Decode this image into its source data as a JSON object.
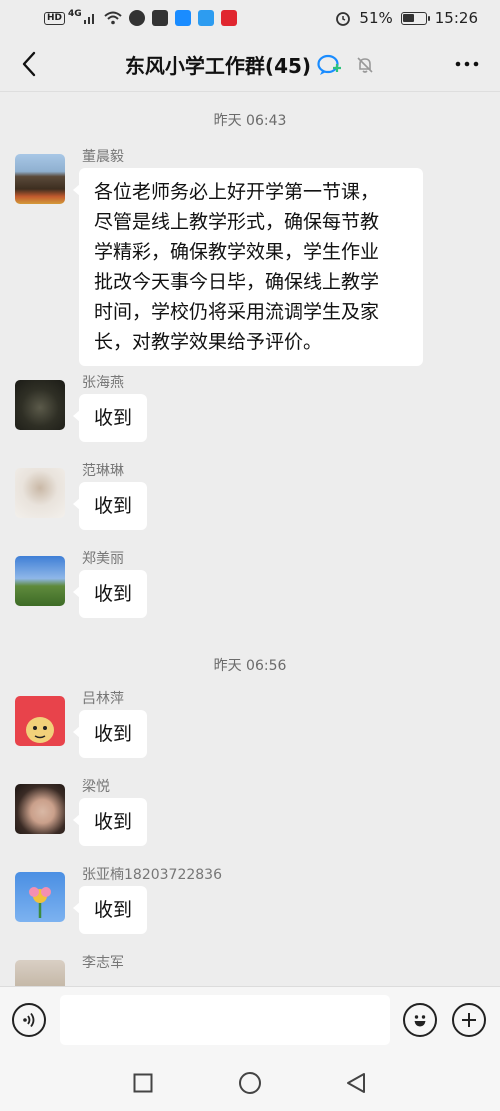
{
  "status_bar": {
    "network": "HD",
    "signal": "4G",
    "battery_text": "51%",
    "battery_level": 0.51,
    "time": "15:26",
    "notification_icons": [
      "wifi-icon",
      "alarm-icon",
      "vpn-icon",
      "app-icon",
      "cloud-icon",
      "app-icon"
    ]
  },
  "header": {
    "title": "东风小学工作群(45)"
  },
  "chat": {
    "timestamps": [
      "昨天 06:43",
      "昨天 06:56"
    ],
    "messages": [
      {
        "sender": "董晨毅",
        "text": "各位老师务必上好开学第一节课，尽管是线上教学形式，确保每节教学精彩，确保教学效果，学生作业批改今天事今日毕，确保线上教学时间，学校仍将采用流调学生及家长，对教学效果给予评价。",
        "lines": [
          "各位老师务必上好开学第一节课，",
          "尽管是线上教学形式，确保每节教",
          "学精彩，确保教学效果，学生作业",
          "批改今天事今日毕，确保线上教学",
          "时间，学校仍将采用流调学生及家",
          "长，对教学效果给予评价。"
        ]
      },
      {
        "sender": "张海燕",
        "text": "收到"
      },
      {
        "sender": "范琳琳",
        "text": "收到"
      },
      {
        "sender": "郑美丽",
        "text": "收到"
      },
      {
        "sender": "吕林萍",
        "text": "收到"
      },
      {
        "sender": "梁悦",
        "text": "收到"
      },
      {
        "sender": "张亚楠18203722836",
        "text": "收到"
      },
      {
        "sender": "李志军",
        "text": ""
      }
    ]
  },
  "input_bar": {
    "value": "",
    "placeholder": ""
  },
  "colors": {
    "background": "#ededed",
    "bubble": "#ffffff",
    "accent_blue": "#1a8cff"
  }
}
